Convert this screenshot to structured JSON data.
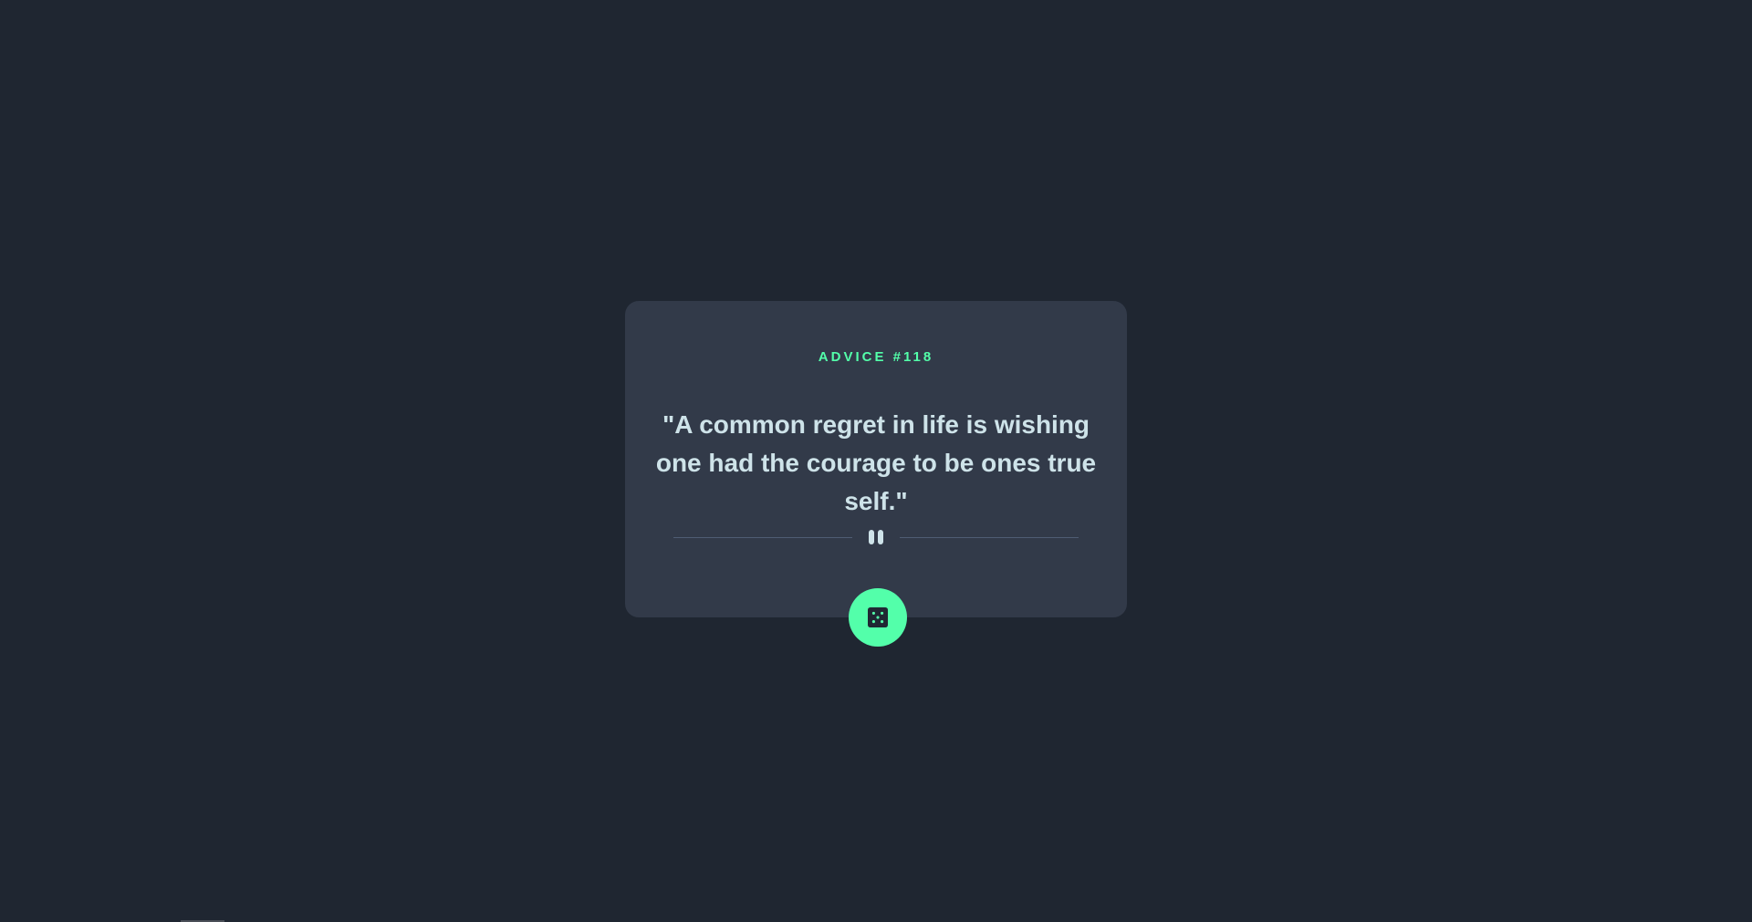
{
  "card": {
    "advice_label": "ADVICE #118",
    "quote": "\"A common regret in life is wishing one had the courage to be ones true self.\""
  },
  "icons": {
    "divider": "pause-icon",
    "dice": "dice-icon"
  },
  "colors": {
    "background": "#1f2631",
    "card": "#323a49",
    "accent": "#53ffaa",
    "quote_text": "#cee3e9",
    "divider": "#4f5d74"
  }
}
